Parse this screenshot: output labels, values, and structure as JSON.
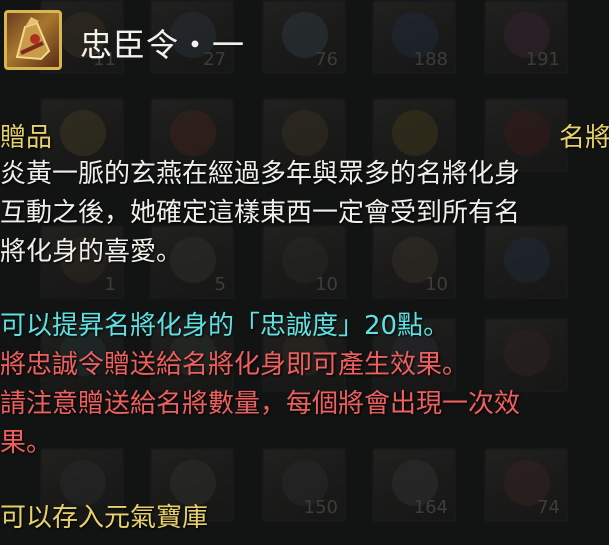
{
  "tooltip": {
    "title": "忠臣令・一",
    "icon": "scroll-bag-icon",
    "category_left": "贈品",
    "category_right": "名將",
    "description": [
      "炎黃一脈的玄燕在經過多年與眾多的名將化身",
      "互動之後，她確定這樣東西一定會受到所有名",
      "將化身的喜愛。"
    ],
    "effect": "可以提昇名將化身的「忠誠度」20點。",
    "notes": [
      "將忠誠令贈送給名將化身即可產生效果。",
      "請注意贈送給名將數量，每個將會出現一次效",
      "果。"
    ],
    "storage": "可以存入元氣寶庫"
  },
  "inventory": {
    "counts": [
      "11",
      "27",
      "76",
      "188",
      "191",
      "1",
      "5",
      "10",
      "10",
      "150",
      "164",
      "74"
    ]
  },
  "colors": {
    "title": "#f2f2ee",
    "category": "#e8d16c",
    "description": "#f0efe9",
    "effect": "#5fe0e2",
    "notes": "#ee5f5f",
    "storage": "#e8d16c"
  }
}
